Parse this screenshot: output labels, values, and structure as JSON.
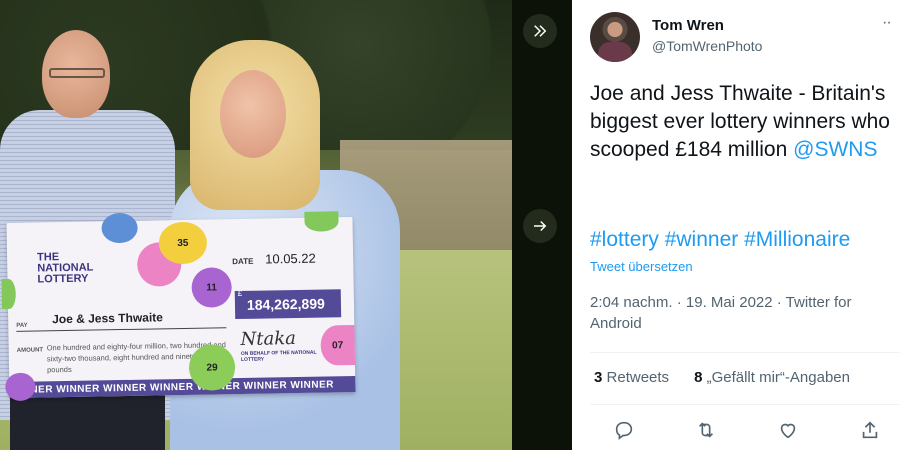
{
  "photo": {
    "cheque": {
      "brand": "THE NATIONAL LOTTERY",
      "date_label": "DATE",
      "date": "10.05.22",
      "currency_symbol": "£",
      "amount": "184,262,899",
      "pay_label": "PAY",
      "payee": "Joe & Jess Thwaite",
      "amount_label": "AMOUNT",
      "amount_words": "One hundred and eighty-four million, two hundred and sixty-two thousand, eight hundred and ninety-nine pounds",
      "signature": "Ntaka",
      "signature_caption": "ON BEHALF OF THE NATIONAL LOTTERY",
      "banner": "INNER WINNER WINNER WINNER WINNER WINNER WINNER"
    },
    "balls": [
      "35",
      "11",
      "29",
      "07"
    ]
  },
  "carousel": {
    "collapse_icon": "double-chevron-right-icon",
    "next_icon": "arrow-right-icon"
  },
  "tweet": {
    "author": {
      "name": "Tom Wren",
      "handle": "@TomWrenPhoto"
    },
    "text": "Joe and Jess Thwaite - Britain's biggest ever lottery winners who scooped £184 million",
    "mention": "@SWNS",
    "hashtags": "#lottery #winner #Millionaire",
    "translate_label": "Tweet übersetzen",
    "timestamp": "2:04 nachm. · 19. Mai 2022 · Twitter for Android",
    "retweets_count": "3",
    "retweets_label": "Retweets",
    "likes_count": "8",
    "likes_label": "„Gefällt mir“-Angaben",
    "actions": [
      "reply-icon",
      "retweet-icon",
      "like-icon",
      "share-icon"
    ]
  },
  "colors": {
    "accent": "#1d9bf0",
    "text_primary": "#0f1419",
    "text_secondary": "#536471",
    "cheque_purple": "#544b98"
  }
}
